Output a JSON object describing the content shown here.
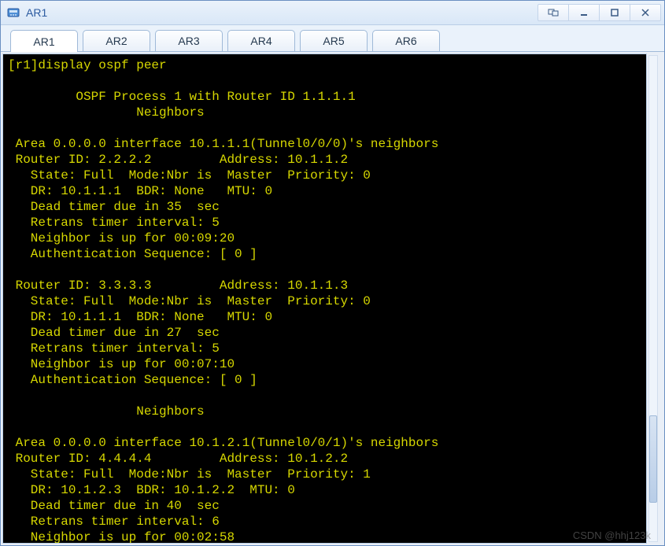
{
  "window": {
    "title": "AR1"
  },
  "tabs": [
    {
      "label": "AR1",
      "active": true
    },
    {
      "label": "AR2",
      "active": false
    },
    {
      "label": "AR3",
      "active": false
    },
    {
      "label": "AR4",
      "active": false
    },
    {
      "label": "AR5",
      "active": false
    },
    {
      "label": "AR6",
      "active": false
    }
  ],
  "watermark": "CSDN @hhj123k",
  "terminal": {
    "prompt": "[r1]display ospf peer",
    "header1": "\t OSPF Process 1 with Router ID 1.1.1.1",
    "header2": "\t\t Neighbors ",
    "area1_header": " Area 0.0.0.0 interface 10.1.1.1(Tunnel0/0/0)'s neighbors",
    "n1": {
      "l1": " Router ID: 2.2.2.2         Address: 10.1.1.2        ",
      "l2": "   State: Full  Mode:Nbr is  Master  Priority: 0",
      "l3": "   DR: 10.1.1.1  BDR: None   MTU: 0    ",
      "l4": "   Dead timer due in 35  sec ",
      "l5": "   Retrans timer interval: 5 ",
      "l6": "   Neighbor is up for 00:09:20     ",
      "l7": "   Authentication Sequence: [ 0 ] "
    },
    "n2": {
      "l1": " Router ID: 3.3.3.3         Address: 10.1.1.3        ",
      "l2": "   State: Full  Mode:Nbr is  Master  Priority: 0",
      "l3": "   DR: 10.1.1.1  BDR: None   MTU: 0    ",
      "l4": "   Dead timer due in 27  sec ",
      "l5": "   Retrans timer interval: 5 ",
      "l6": "   Neighbor is up for 00:07:10     ",
      "l7": "   Authentication Sequence: [ 0 ] "
    },
    "sep": "\t\t Neighbors ",
    "area2_header": " Area 0.0.0.0 interface 10.1.2.1(Tunnel0/0/1)'s neighbors",
    "n3": {
      "l1": " Router ID: 4.4.4.4         Address: 10.1.2.2        ",
      "l2": "   State: Full  Mode:Nbr is  Master  Priority: 1",
      "l3": "   DR: 10.1.2.3  BDR: 10.1.2.2  MTU: 0    ",
      "l4": "   Dead timer due in 40  sec ",
      "l5": "   Retrans timer interval: 6 ",
      "l6": "   Neighbor is up for 00:02:58     "
    }
  }
}
